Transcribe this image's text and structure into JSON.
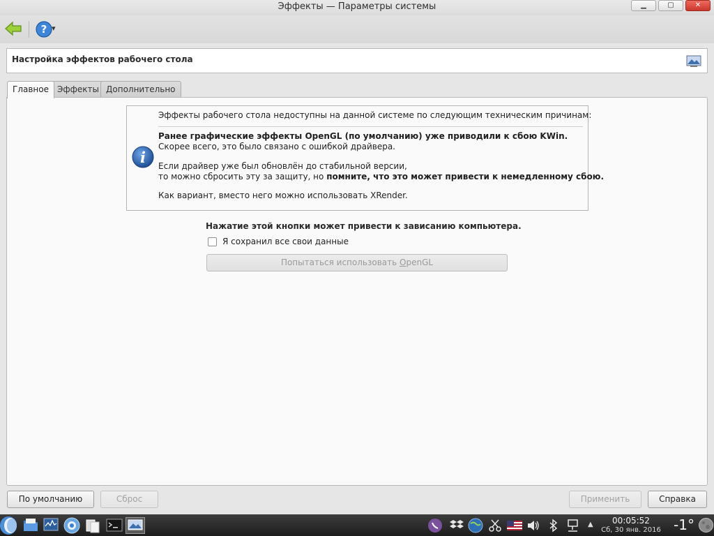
{
  "window": {
    "title": "Эффекты — Параметры системы",
    "controls": {
      "minimize": "▁",
      "maximize": "▢",
      "close": "✕"
    }
  },
  "toolbar": {
    "back_icon": "back-arrow-icon",
    "help_icon": "help-icon",
    "help_menu_arrow": "▾"
  },
  "header": {
    "title": "Настройка эффектов рабочего стола"
  },
  "tabs": [
    {
      "label": "Главное",
      "active": true
    },
    {
      "label": "Эффекты",
      "active": false
    },
    {
      "label": "Дополнительно",
      "active": false
    }
  ],
  "info": {
    "intro": "Эффекты рабочего стола недоступны на данной системе по следующим техническим причинам:",
    "line1_bold": "Ранее графические эффекты OpenGL (по умолчанию) уже приводили к сбою KWin.",
    "line2": "Скорее всего, это было связано с ошибкой драйвера.",
    "line3": "Если драйвер уже был обновлён до стабильной версии,",
    "line4_normal": "то можно сбросить эту за защиту, но ",
    "line4_bold": "помните, что это может привести к немедленному сбою.",
    "line5": "Как вариант, вместо него можно использовать XRender."
  },
  "warning": "Нажатие этой кнопки может привести к зависанию компьютера.",
  "checkbox": {
    "label": "Я сохранил все свои данные",
    "checked": false
  },
  "opengl_button": {
    "prefix": "Попытаться использовать ",
    "accel": "O",
    "suffix": "penGL"
  },
  "footer": {
    "defaults": "По умолчанию",
    "reset": "Сброс",
    "apply": "Применить",
    "help": "Справка"
  },
  "taskbar": {
    "clock_time": "00:05:52",
    "clock_date": "Сб, 30 янв. 2016",
    "temperature": "-1°"
  },
  "colors": {
    "accent_blue": "#2f6fb5",
    "disabled_text": "#a3a3a3",
    "taskbar_bg": "#2a2a2a"
  }
}
